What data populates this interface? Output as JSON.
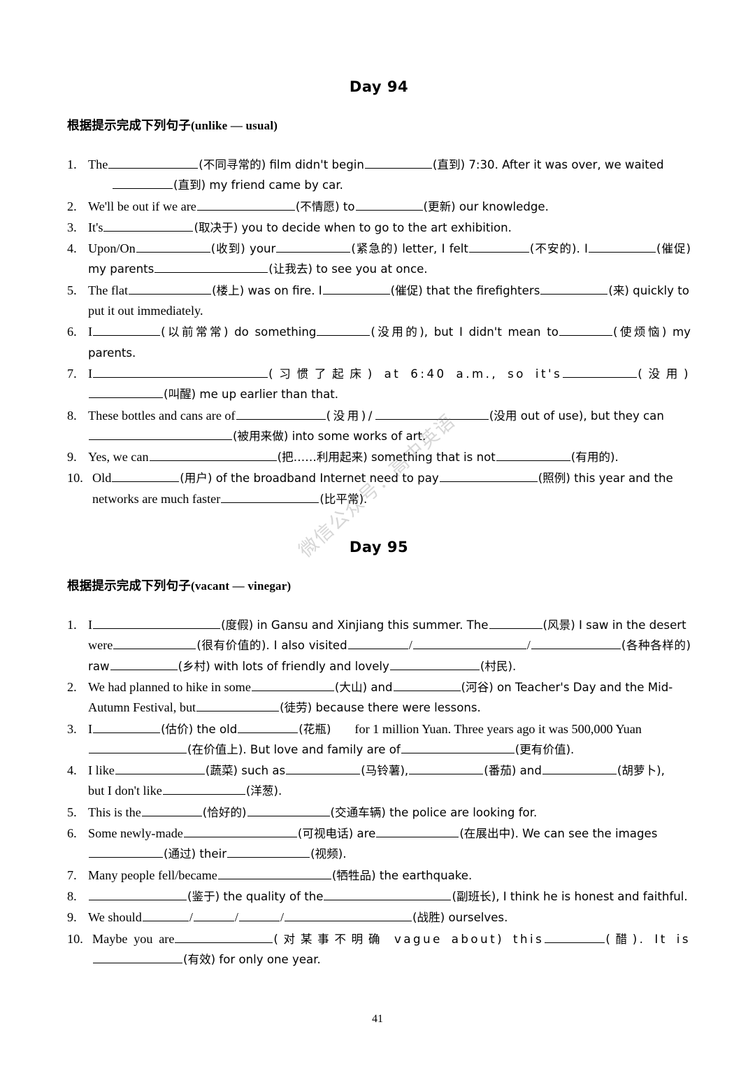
{
  "document": {
    "page_number": "41",
    "watermark": "微信公众号：高中英语"
  },
  "sections": [
    {
      "title": "Day 94",
      "instruction_cn": "根据提示完成下列句子",
      "instruction_range": "(unlike — usual)",
      "items": [
        {
          "num": "1.",
          "parts": [
            "The",
            "(不同寻常的) film didn't begin",
            "(直到) 7:30. After it was over, we waited",
            "(直到) my friend came by car."
          ]
        },
        {
          "num": "2.",
          "parts": [
            "We'll be out if we are",
            "(不情愿) to",
            "(更新) our knowledge."
          ]
        },
        {
          "num": "3.",
          "parts": [
            "It's",
            "(取决于) you to decide when to go to the art exhibition."
          ]
        },
        {
          "num": "4.",
          "parts": [
            "Upon/On",
            "(收到) your",
            "(紧急的) letter, I felt",
            "(不安的). I",
            "(催促) my parents",
            "(让我去) to see you at once."
          ]
        },
        {
          "num": "5.",
          "parts": [
            "The flat",
            "(楼上) was on fire. I",
            "(催促) that the firefighters",
            "(来) quickly to",
            "put it out immediately."
          ]
        },
        {
          "num": "6.",
          "parts": [
            "I",
            "(以前常常) do something",
            "(没用的), but I didn't mean to",
            "(使烦恼) my parents."
          ]
        },
        {
          "num": "7.",
          "parts": [
            "I",
            "(习惯了起床) at 6:40 a.m., so it's",
            "(没用)",
            "(叫醒) me up earlier than that."
          ]
        },
        {
          "num": "8.",
          "parts": [
            "These bottles and cans are of",
            "(没用)/",
            "(没用 out of use), but they can",
            "(被用来做) into some works of art."
          ]
        },
        {
          "num": "9.",
          "parts": [
            "Yes, we can",
            "(把……利用起来) something that is not",
            "(有用的)."
          ]
        },
        {
          "num": "10.",
          "parts": [
            "Old",
            "(用户) of the broadband Internet need to pay",
            "(照例) this year and the",
            "networks are much faster",
            "(比平常)."
          ]
        }
      ]
    },
    {
      "title": "Day 95",
      "instruction_cn": "根据提示完成下列句子",
      "instruction_range": "(vacant — vinegar)",
      "items": [
        {
          "num": "1.",
          "parts": [
            "I",
            "(度假) in Gansu and Xinjiang this summer. The",
            "(风景) I saw in the desert",
            "were",
            "(很有价值的). I also visited",
            "/",
            "/",
            "(各种各样的) raw",
            "(乡村) with lots of friendly and lovely",
            "(村民)."
          ]
        },
        {
          "num": "2.",
          "parts": [
            "We had planned to hike in some",
            "(大山) and",
            "(河谷) on Teacher's Day and the Mid-",
            "Autumn Festival, but",
            "(徒劳) because there were lessons."
          ]
        },
        {
          "num": "3.",
          "parts": [
            "I",
            "(估价) the old",
            "(花瓶)",
            "for 1 million Yuan. Three years ago it was 500,000 Yuan",
            "(在价值上). But love and family are of",
            "(更有价值)."
          ]
        },
        {
          "num": "4.",
          "parts": [
            "I like",
            "(蔬菜) such as",
            "(马铃薯),",
            "(番茄) and",
            "(胡萝卜),",
            "but I don't like",
            "(洋葱)."
          ]
        },
        {
          "num": "5.",
          "parts": [
            "This is the",
            "(恰好的)",
            "(交通车辆) the police are looking for."
          ]
        },
        {
          "num": "6.",
          "parts": [
            "Some newly-made",
            "(可视电话) are",
            "(在展出中). We can see the images",
            "(通过) their",
            "(视频)."
          ]
        },
        {
          "num": "7.",
          "parts": [
            "Many people fell/became",
            "(牺牲品) the earthquake."
          ]
        },
        {
          "num": "8.",
          "parts": [
            "",
            "(鉴于) the quality of the",
            "(副班长), I think he is honest and faithful."
          ]
        },
        {
          "num": "9.",
          "parts": [
            "We should",
            "/",
            "/",
            "/",
            "(战胜) ourselves."
          ]
        },
        {
          "num": "10.",
          "parts": [
            "Maybe you are",
            "(对某事不明确 vague about) this",
            "(醋). It is",
            "(有效) for only one year."
          ]
        }
      ]
    }
  ]
}
